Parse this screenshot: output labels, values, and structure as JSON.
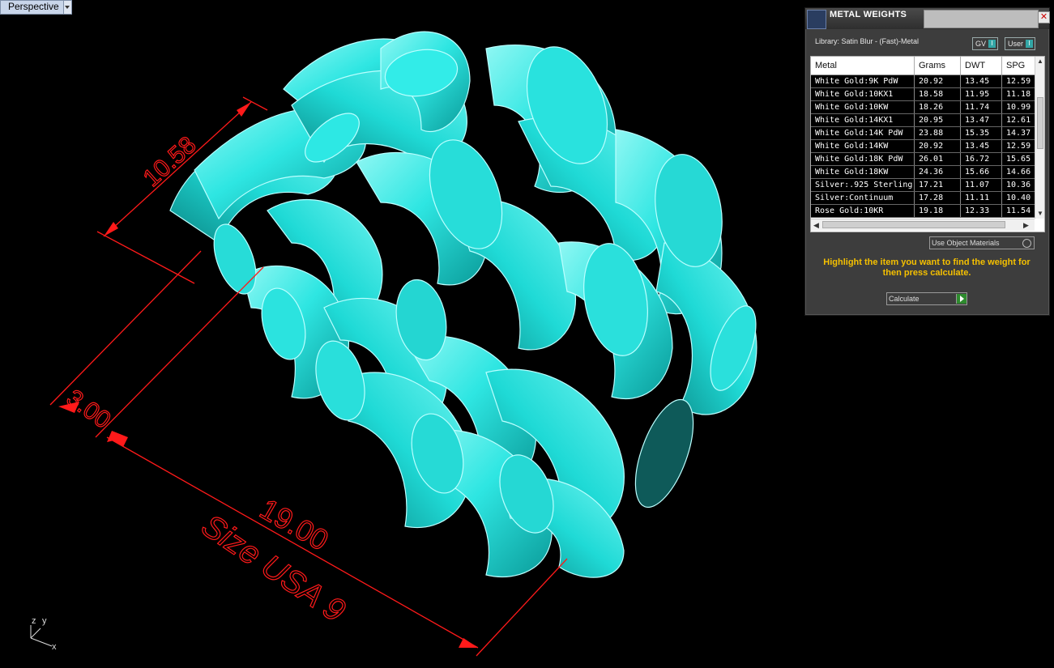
{
  "viewport": {
    "label": "Perspective"
  },
  "dimensions": {
    "width_value": "10.58",
    "band_value": "3.00",
    "size_value": "19.00",
    "size_text": "Size USA 9",
    "color": "#ff1a1a"
  },
  "model": {
    "color": "#1fe3e0"
  },
  "axes": {
    "z": "z",
    "y": "y",
    "x": "x"
  },
  "panel": {
    "title": "METAL WEIGHTS",
    "close_icon": "close-icon",
    "library": "Library: Satin Blur - (Fast)-Metal",
    "toggle_gv": {
      "label": "GV",
      "value": "I"
    },
    "toggle_user": {
      "label": "User",
      "value": "I"
    },
    "columns": [
      "Metal",
      "Grams",
      "DWT",
      "SPG"
    ],
    "rows": [
      [
        "White Gold:9K PdW",
        "20.92",
        "13.45",
        "12.59"
      ],
      [
        "White Gold:10KX1",
        "18.58",
        "11.95",
        "11.18"
      ],
      [
        "White Gold:10KW",
        "18.26",
        "11.74",
        "10.99"
      ],
      [
        "White Gold:14KX1",
        "20.95",
        "13.47",
        "12.61"
      ],
      [
        "White Gold:14K PdW",
        "23.88",
        "15.35",
        "14.37"
      ],
      [
        "White Gold:14KW",
        "20.92",
        "13.45",
        "12.59"
      ],
      [
        "White Gold:18K PdW",
        "26.01",
        "16.72",
        "15.65"
      ],
      [
        "White Gold:18KW",
        "24.36",
        "15.66",
        "14.66"
      ],
      [
        "Silver:.925 Sterling",
        "17.21",
        "11.07",
        "10.36"
      ],
      [
        "Silver:Continuum",
        "17.28",
        "11.11",
        "10.40"
      ],
      [
        "Rose Gold:10KR",
        "19.18",
        "12.33",
        "11.54"
      ]
    ],
    "use_object_materials": "Use Object Materials",
    "instruction": "Highlight the item you want to find the weight for then press calculate.",
    "calculate": "Calculate",
    "accent": "#f5c000"
  }
}
